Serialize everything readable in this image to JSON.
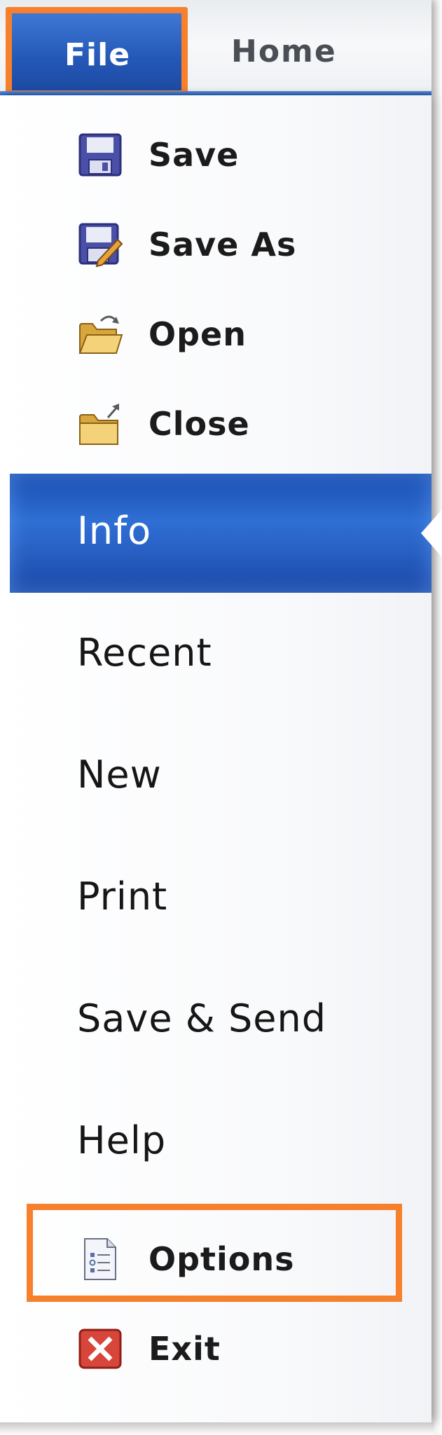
{
  "ribbon": {
    "file_tab": "File",
    "home_tab": "Home"
  },
  "file_menu": {
    "commands_top": [
      {
        "label": "Save",
        "icon": "save-icon"
      },
      {
        "label": "Save As",
        "icon": "save-as-icon"
      },
      {
        "label": "Open",
        "icon": "open-folder-icon"
      },
      {
        "label": "Close",
        "icon": "close-folder-icon"
      }
    ],
    "tabs": [
      {
        "label": "Info",
        "selected": true
      },
      {
        "label": "Recent"
      },
      {
        "label": "New"
      },
      {
        "label": "Print"
      },
      {
        "label": "Save & Send"
      },
      {
        "label": "Help"
      }
    ],
    "commands_bottom": [
      {
        "label": "Options",
        "icon": "options-icon",
        "highlighted": true
      },
      {
        "label": "Exit",
        "icon": "exit-icon"
      }
    ]
  },
  "colors": {
    "accent_blue": "#2458b7",
    "highlight_orange": "#f6802b"
  }
}
